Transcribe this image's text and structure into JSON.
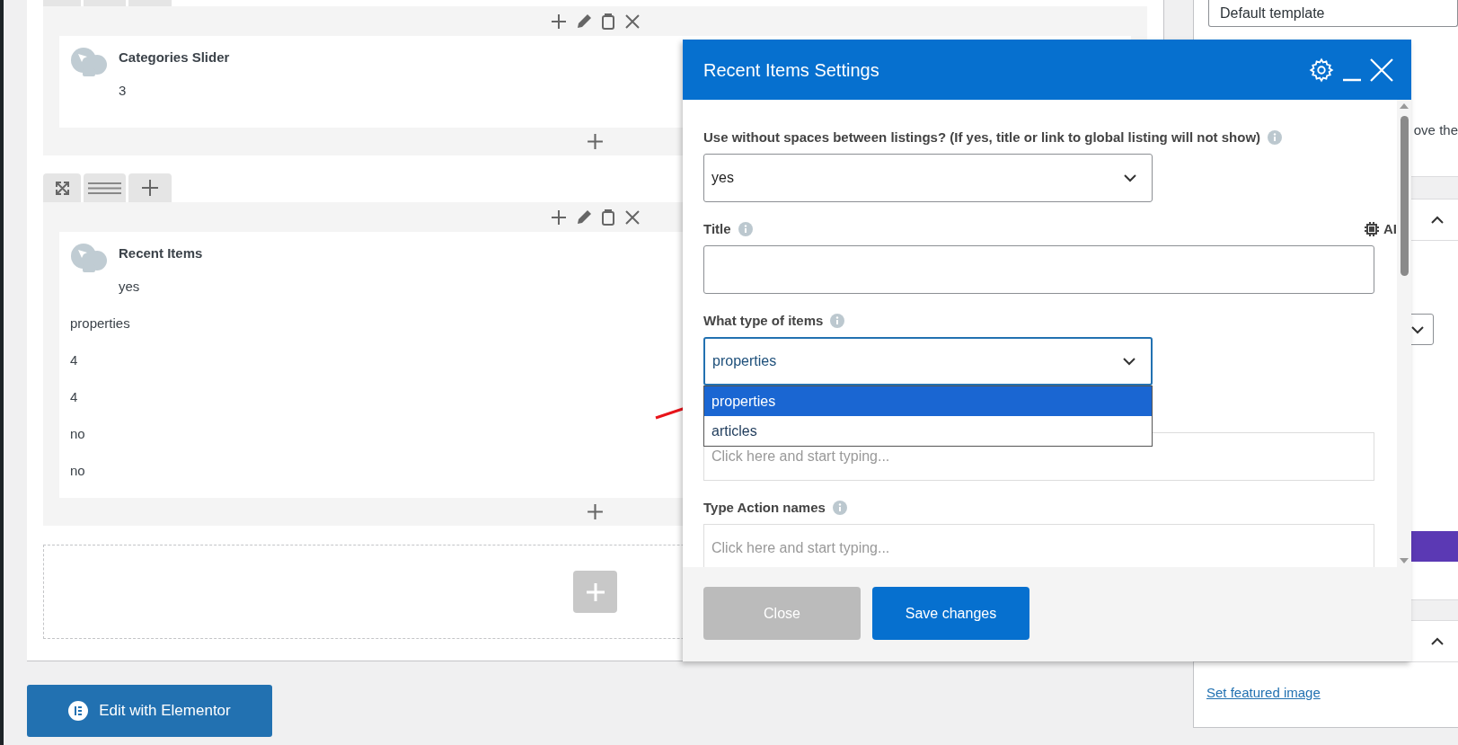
{
  "sections": [
    {
      "tabs_cut": true,
      "widget": {
        "title": "Categories Slider",
        "summary": "3"
      }
    },
    {
      "tabs_cut": false,
      "widget": {
        "title": "Recent Items",
        "summary": "yes",
        "values": [
          "properties",
          "4",
          "4",
          "no",
          "no"
        ]
      }
    }
  ],
  "edit_button": "Edit with Elementor",
  "sidebar": {
    "template_select": "Default template",
    "text_fragment": "ove the",
    "featured_link": "Set featured image"
  },
  "modal": {
    "title": "Recent Items Settings",
    "fields": [
      {
        "kind": "select",
        "label": "Use without spaces between listings? (If yes, title or link to global listing will not show)",
        "value": "yes",
        "open": false
      },
      {
        "kind": "text",
        "label": "Title",
        "ai_label": "AI"
      },
      {
        "kind": "select",
        "label": "What type of items",
        "value": "properties",
        "open": true,
        "options": [
          {
            "label": "properties",
            "selected": true
          },
          {
            "label": "articles",
            "selected": false
          }
        ]
      },
      {
        "kind": "text",
        "placeholder": "Click here and start typing..."
      },
      {
        "kind": "text",
        "label": "Type Action names",
        "placeholder": "Click here and start typing..."
      }
    ],
    "buttons": [
      {
        "kind": "secondary",
        "label": "Close"
      },
      {
        "kind": "primary",
        "label": "Save changes"
      }
    ]
  }
}
